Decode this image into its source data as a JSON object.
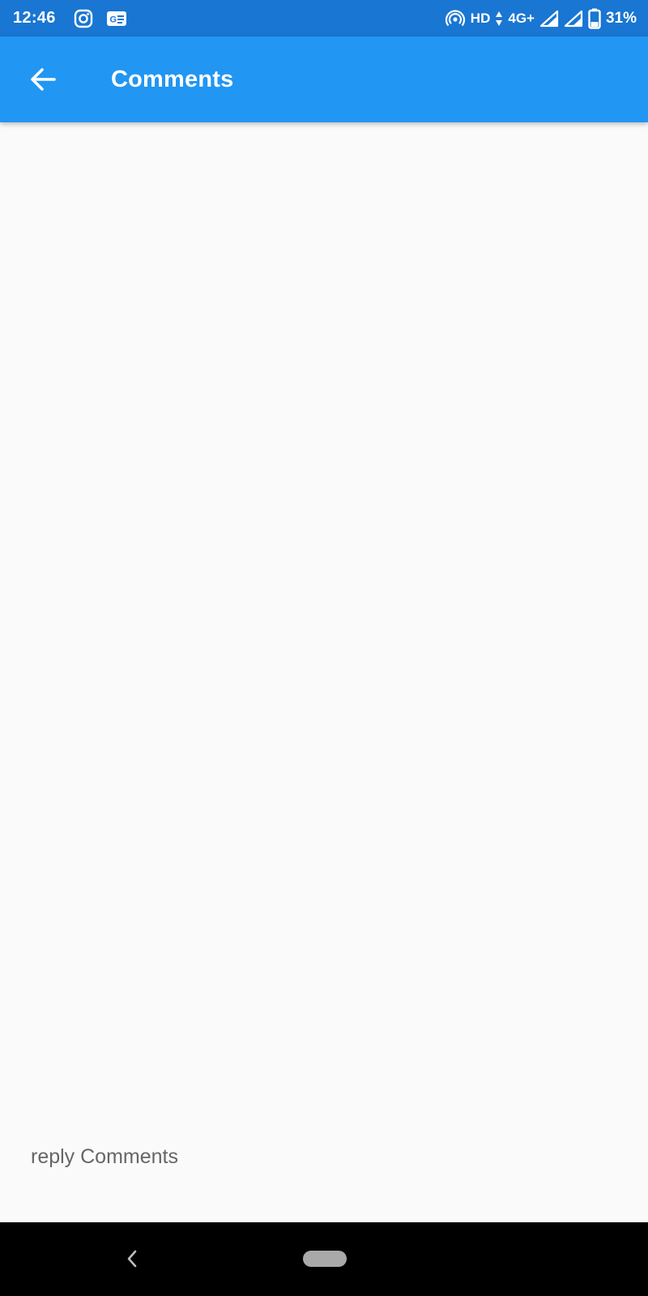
{
  "status_bar": {
    "time": "12:46",
    "network_hd": "HD",
    "network_type": "4G+",
    "battery_percent": "31%",
    "icons": [
      "instagram-icon",
      "news-icon",
      "hotspot-icon",
      "data-arrows-icon",
      "signal-icon",
      "signal-icon",
      "battery-icon"
    ]
  },
  "app_bar": {
    "title": "Comments",
    "back_icon": "arrow-left-icon"
  },
  "reply": {
    "placeholder": "reply Comments",
    "value": ""
  },
  "nav_bar": {
    "icons": [
      "back-chevron-icon",
      "home-pill-icon"
    ]
  },
  "colors": {
    "status_bar": "#1976d2",
    "app_bar": "#2196f3",
    "background": "#fafafa",
    "nav_bar": "#000000"
  }
}
